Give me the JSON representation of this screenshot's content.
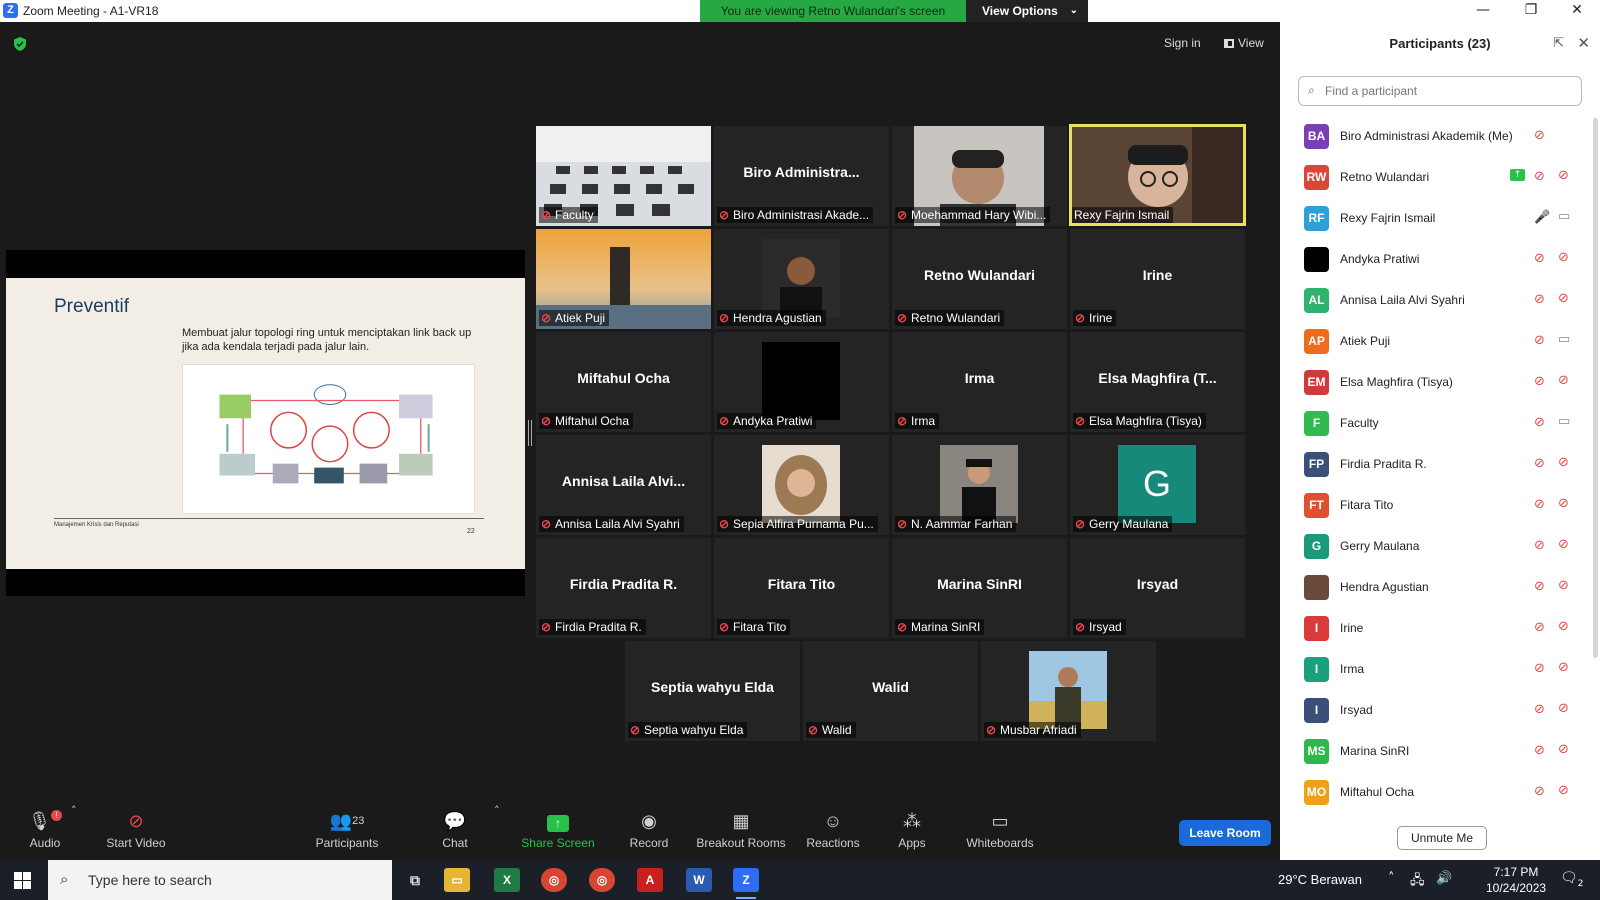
{
  "window": {
    "title": "Zoom Meeting - A1-VR18",
    "min": "—",
    "max": "❐",
    "close": "✕"
  },
  "banner": {
    "viewing": "You are viewing Retno Wulandari's screen",
    "view_options": "View Options"
  },
  "topbar": {
    "sign_in": "Sign in",
    "view": "View"
  },
  "slide": {
    "title": "Preventif",
    "body": "Membuat jalur topologi ring untuk menciptakan link back up jika ada kendala terjadi pada jalur lain.",
    "footer_left": "Manajemen Krisis dan Reputasi",
    "page": "22"
  },
  "tiles": [
    {
      "name": "",
      "label": "Faculty"
    },
    {
      "name": "Biro  Administra...",
      "label": "Biro Administrasi Akade..."
    },
    {
      "name": "",
      "label": "Moehammad Hary Wibi..."
    },
    {
      "name": "",
      "label": "Rexy Fajrin Ismail"
    },
    {
      "name": "",
      "label": "Atiek Puji"
    },
    {
      "name": "",
      "label": "Hendra Agustian"
    },
    {
      "name": "Retno Wulandari",
      "label": "Retno Wulandari"
    },
    {
      "name": "Irine",
      "label": "Irine"
    },
    {
      "name": "Miftahul Ocha",
      "label": "Miftahul Ocha"
    },
    {
      "name": "",
      "label": "Andyka Pratiwi"
    },
    {
      "name": "Irma",
      "label": "Irma"
    },
    {
      "name": "Elsa  Maghfira  (T...",
      "label": "Elsa Maghfira (Tisya)"
    },
    {
      "name": "Annisa  Laila  Alvi...",
      "label": "Annisa Laila Alvi Syahri"
    },
    {
      "name": "",
      "label": "Sepia Alfira Purnama Pu..."
    },
    {
      "name": "",
      "label": "N. Aammar Farhan"
    },
    {
      "name": "G",
      "label": "Gerry Maulana"
    },
    {
      "name": "Firdia Pradita R.",
      "label": "Firdia Pradita R."
    },
    {
      "name": "Fitara Tito",
      "label": "Fitara Tito"
    },
    {
      "name": "Marina SinRI",
      "label": "Marina SinRI"
    },
    {
      "name": "Irsyad",
      "label": "Irsyad"
    },
    {
      "name": "Septia wahyu Elda",
      "label": "Septia wahyu Elda"
    },
    {
      "name": "Walid",
      "label": "Walid"
    },
    {
      "name": "",
      "label": "Musbar Afriadi"
    }
  ],
  "toolbar": {
    "audio": "Audio",
    "start_video": "Start Video",
    "participants": "Participants",
    "participants_count": "23",
    "chat": "Chat",
    "share_screen": "Share Screen",
    "record": "Record",
    "breakout": "Breakout Rooms",
    "reactions": "Reactions",
    "apps": "Apps",
    "whiteboards": "Whiteboards",
    "leave": "Leave Room",
    "audio_badge": "!"
  },
  "panel": {
    "title": "Participants (23)",
    "search_placeholder": "Find a participant",
    "unmute": "Unmute Me",
    "participants": [
      {
        "initials": "BA",
        "name": "Biro Administrasi Akademik (Me)",
        "color": "#7b3fb5",
        "mic": "muted",
        "cam": "none"
      },
      {
        "initials": "RW",
        "name": "Retno Wulandari",
        "color": "#d9473a",
        "mic": "muted",
        "cam": "off",
        "sharing": true
      },
      {
        "initials": "RF",
        "name": "Rexy Fajrin Ismail",
        "color": "#2fa0d6",
        "mic": "on",
        "cam": "on"
      },
      {
        "initials": "",
        "name": "Andyka Pratiwi",
        "color": "#000000",
        "mic": "muted",
        "cam": "off"
      },
      {
        "initials": "AL",
        "name": "Annisa Laila Alvi Syahri",
        "color": "#2db36b",
        "mic": "muted",
        "cam": "off"
      },
      {
        "initials": "AP",
        "name": "Atiek Puji",
        "color": "#ef6c1f",
        "mic": "muted",
        "cam": "on"
      },
      {
        "initials": "EM",
        "name": "Elsa Maghfira (Tisya)",
        "color": "#d03a3a",
        "mic": "muted",
        "cam": "off"
      },
      {
        "initials": "F",
        "name": "Faculty",
        "color": "#2fbb4f",
        "mic": "muted",
        "cam": "on"
      },
      {
        "initials": "FP",
        "name": "Firdia Pradita R.",
        "color": "#3a4f7a",
        "mic": "muted",
        "cam": "off"
      },
      {
        "initials": "FT",
        "name": "Fitara Tito",
        "color": "#e0502f",
        "mic": "muted",
        "cam": "off"
      },
      {
        "initials": "G",
        "name": "Gerry Maulana",
        "color": "#1a9a7a",
        "mic": "muted",
        "cam": "off"
      },
      {
        "initials": "",
        "name": "Hendra Agustian",
        "color": "#6a4a3a",
        "mic": "muted",
        "cam": "off"
      },
      {
        "initials": "I",
        "name": "Irine",
        "color": "#d93a3a",
        "mic": "muted",
        "cam": "off"
      },
      {
        "initials": "I",
        "name": "Irma",
        "color": "#1aa07a",
        "mic": "muted",
        "cam": "off"
      },
      {
        "initials": "I",
        "name": "Irsyad",
        "color": "#3a4f7a",
        "mic": "muted",
        "cam": "off"
      },
      {
        "initials": "MS",
        "name": "Marina SinRI",
        "color": "#2db84a",
        "mic": "muted",
        "cam": "off"
      },
      {
        "initials": "MO",
        "name": "Miftahul Ocha",
        "color": "#f0a018",
        "mic": "muted",
        "cam": "off"
      }
    ]
  },
  "taskbar": {
    "search_placeholder": "Type here to search",
    "weather": "29°C  Berawan",
    "time": "7:17 PM",
    "date": "10/24/2023",
    "notifications": "2"
  }
}
